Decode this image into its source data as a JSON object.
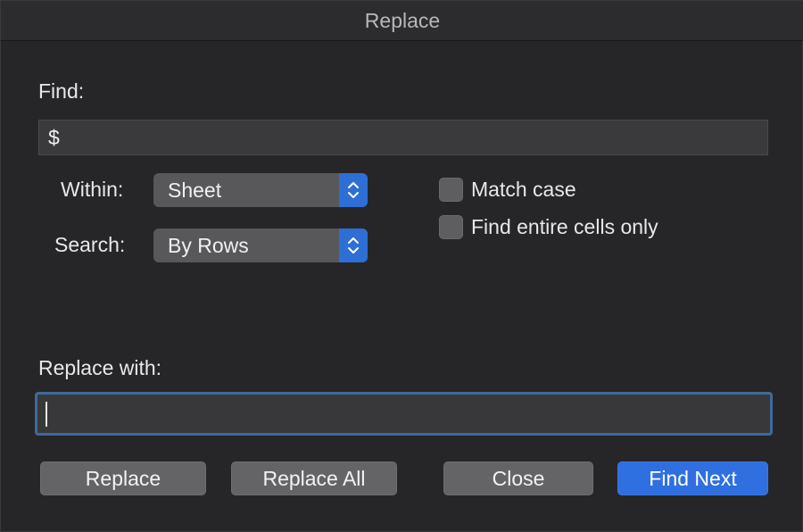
{
  "window": {
    "title": "Replace"
  },
  "find": {
    "label": "Find:",
    "value": "$"
  },
  "within": {
    "label": "Within:",
    "selected": "Sheet"
  },
  "search": {
    "label": "Search:",
    "selected": "By Rows"
  },
  "options": {
    "match_case": "Match case",
    "entire_cells": "Find entire cells only"
  },
  "replace_with": {
    "label": "Replace with:",
    "value": ""
  },
  "buttons": {
    "replace": "Replace",
    "replace_all": "Replace All",
    "close": "Close",
    "find_next": "Find Next"
  },
  "colors": {
    "accent": "#2f6fe0",
    "focus_ring": "#3f6a9a"
  }
}
